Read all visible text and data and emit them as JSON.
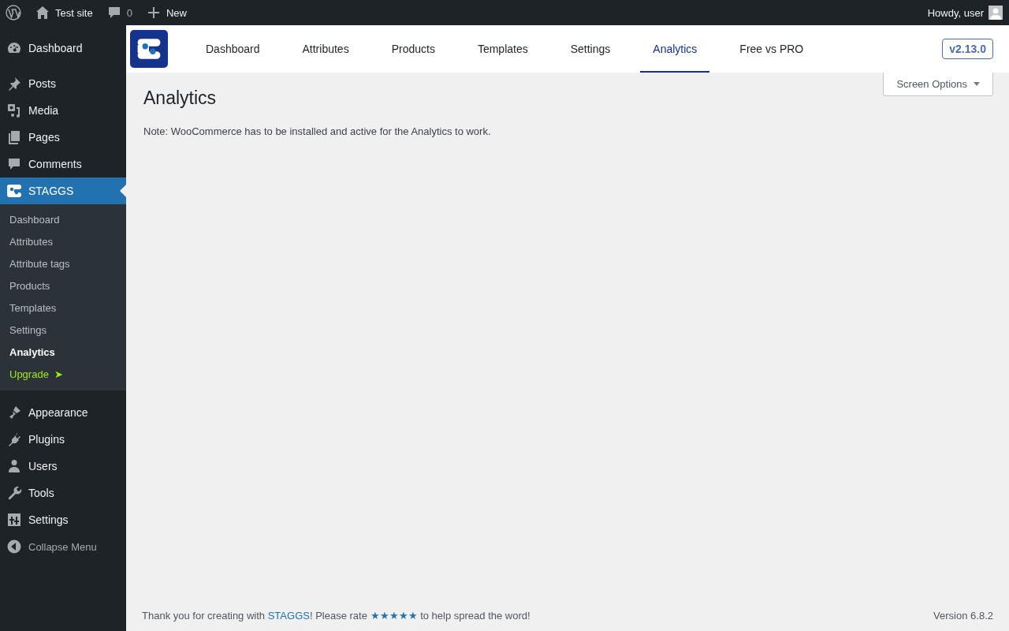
{
  "admin_bar": {
    "site": "Test site",
    "comments": "0",
    "new": "New",
    "greeting": "Howdy, user"
  },
  "sidebar": {
    "items": [
      {
        "label": "Dashboard",
        "selected": false
      },
      {
        "label": "Posts",
        "selected": false
      },
      {
        "label": "Media",
        "selected": false
      },
      {
        "label": "Pages",
        "selected": false
      },
      {
        "label": "Comments",
        "selected": false
      },
      {
        "label": "STAGGS",
        "selected": true
      }
    ],
    "submenu": [
      {
        "label": "Dashboard",
        "selected": false,
        "kind": "link"
      },
      {
        "label": "Attributes",
        "selected": false,
        "kind": "link"
      },
      {
        "label": "Attribute tags",
        "selected": false,
        "kind": "link"
      },
      {
        "label": "Products",
        "selected": false,
        "kind": "link"
      },
      {
        "label": "Templates",
        "selected": false,
        "kind": "link"
      },
      {
        "label": "Settings",
        "selected": false,
        "kind": "link"
      },
      {
        "label": "Analytics",
        "selected": true,
        "kind": "link"
      },
      {
        "label": "Upgrade",
        "selected": false,
        "kind": "upgrade",
        "arrow": "➤"
      }
    ],
    "items_after": [
      {
        "label": "Appearance",
        "selected": false
      },
      {
        "label": "Plugins",
        "selected": false
      },
      {
        "label": "Users",
        "selected": false
      },
      {
        "label": "Tools",
        "selected": false
      },
      {
        "label": "Settings",
        "selected": false
      }
    ],
    "collapse": "Collapse Menu"
  },
  "plugin_header": {
    "tabs": [
      {
        "label": "Dashboard",
        "selected": false
      },
      {
        "label": "Attributes",
        "selected": false
      },
      {
        "label": "Products",
        "selected": false
      },
      {
        "label": "Templates",
        "selected": false
      },
      {
        "label": "Settings",
        "selected": false
      },
      {
        "label": "Analytics",
        "selected": true
      },
      {
        "label": "Free vs PRO",
        "selected": false
      }
    ],
    "version": "v2.13.0"
  },
  "screen_options": "Screen Options",
  "page": {
    "title": "Analytics",
    "note": "Note: WooCommerce has to be installed and active for the Analytics to work."
  },
  "footer": {
    "text_1": "Thank you for creating with ",
    "link_1": "STAGGS",
    "text_2": "! Please rate ",
    "link_2": "★★★★★",
    "text_3": " to help spread the word!",
    "version": "Version 6.8.2"
  }
}
